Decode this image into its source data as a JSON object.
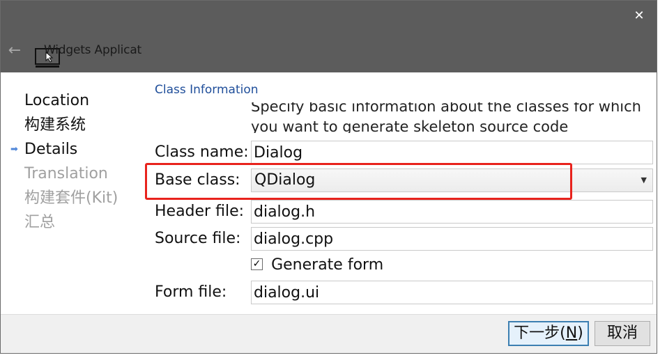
{
  "window": {
    "title": "Widgets Applicat",
    "close_icon": "close-icon",
    "back_icon": "back-arrow-icon",
    "app_icon": "monitor-cursor-icon"
  },
  "sidebar": {
    "items": [
      {
        "label": "Location",
        "state": "done"
      },
      {
        "label": "构建系统",
        "state": "done"
      },
      {
        "label": "Details",
        "state": "current",
        "marker": "➡"
      },
      {
        "label": "Translation",
        "state": "pending"
      },
      {
        "label": "构建套件(Kit)",
        "state": "pending"
      },
      {
        "label": "汇总",
        "state": "pending"
      }
    ]
  },
  "main": {
    "section_title": "Class Information",
    "subtitle": "Specify basic information about the classes for which you want to generate skeleton source code",
    "class_name": {
      "label": "Class name:",
      "value": "Dialog"
    },
    "base_class": {
      "label": "Base class:",
      "value": "QDialog"
    },
    "header_file": {
      "label": "Header file:",
      "value": "dialog.h"
    },
    "source_file": {
      "label": "Source file:",
      "value": "dialog.cpp"
    },
    "generate_form": {
      "label": "Generate form",
      "checked": true,
      "mark": "✓"
    },
    "form_file": {
      "label": "Form file:",
      "value": "dialog.ui"
    }
  },
  "footer": {
    "next_label_prefix": "下一步(",
    "next_label_mnemonic": "N",
    "next_label_suffix": ")",
    "cancel_label": "取消"
  },
  "colors": {
    "titlebar": "#5c5c5c",
    "section_title": "#1f4e9a",
    "highlight": "#e8231d",
    "primary_border": "#3c7fb1"
  }
}
